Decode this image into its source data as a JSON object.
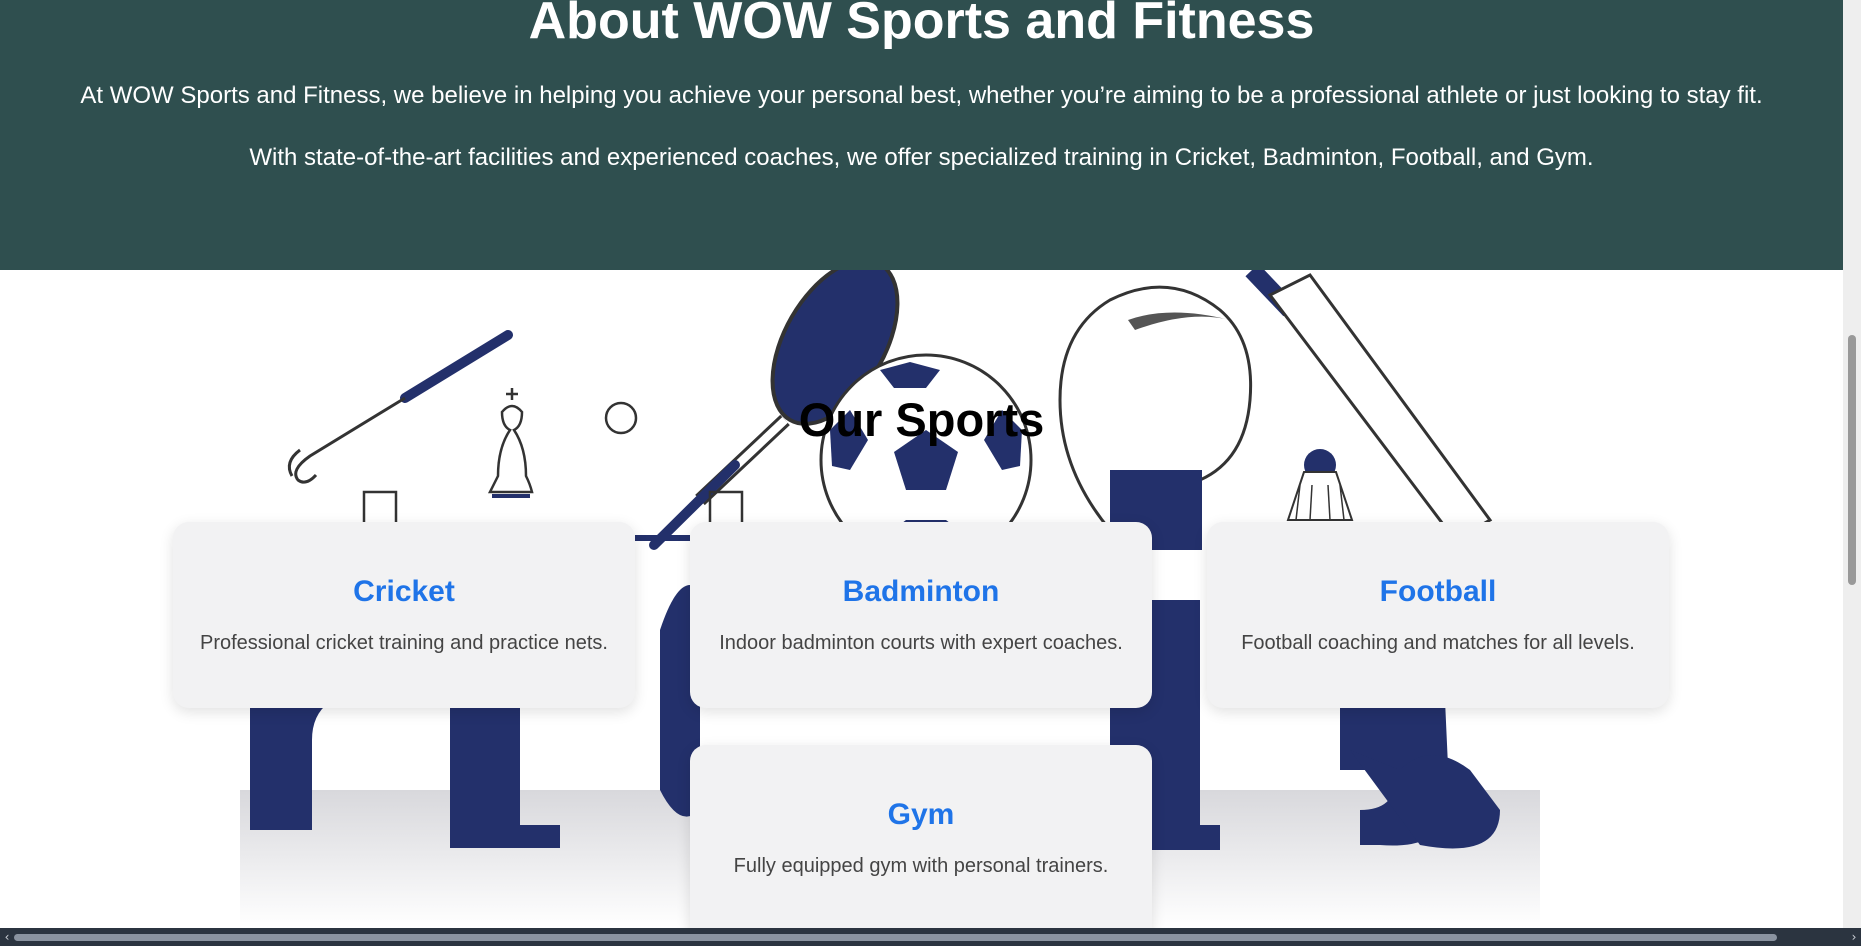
{
  "about": {
    "title": "About WOW Sports and Fitness",
    "paragraph1": "At WOW Sports and Fitness, we believe in helping you achieve your personal best, whether you’re aiming to be a professional athlete or just looking to stay fit.",
    "paragraph2": "With state-of-the-art facilities and experienced coaches, we offer specialized training in Cricket, Badminton, Football, and Gym."
  },
  "sports": {
    "title": "Our Sports",
    "cards": [
      {
        "title": "Cricket",
        "description": "Professional cricket training and practice nets."
      },
      {
        "title": "Badminton",
        "description": "Indoor badminton courts with expert coaches."
      },
      {
        "title": "Football",
        "description": "Football coaching and matches for all levels."
      },
      {
        "title": "Gym",
        "description": "Fully equipped gym with personal trainers."
      }
    ]
  },
  "scrollbars": {
    "left_arrow": "‹",
    "right_arrow": "›"
  },
  "colors": {
    "about_bg": "#2f4f4f",
    "accent": "#1f74e8",
    "navy": "#23306b"
  }
}
